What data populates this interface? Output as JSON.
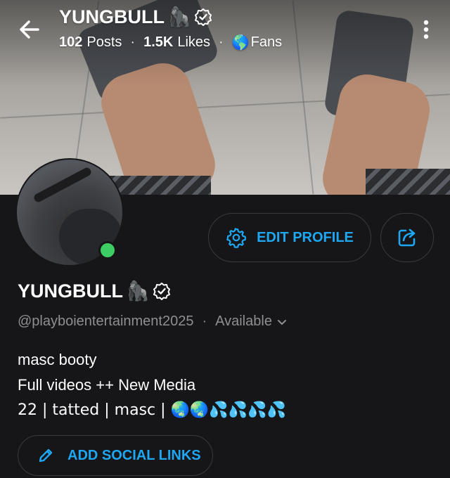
{
  "header": {
    "title": "YUNGBULL",
    "title_emoji": "🦍",
    "posts_count": "102",
    "posts_label": "Posts",
    "likes_count": "1.5K",
    "likes_label": "Likes",
    "fans_emoji": "🌎",
    "fans_label": "Fans",
    "separator": "·"
  },
  "profile": {
    "name": "YUNGBULL",
    "name_emoji": "🦍",
    "handle": "@playboientertainment2025",
    "separator": "·",
    "status": "Available",
    "online_color": "#3ccd64"
  },
  "actions": {
    "edit_profile_label": "EDIT PROFILE",
    "add_social_links_label": "ADD SOCIAL LINKS"
  },
  "bio": {
    "lines": [
      "masc booty",
      "Full videos ++ New Media",
      "22 | tatted | masc | 🌏🌏💦💦💦💦"
    ]
  },
  "icons": {
    "back": "arrow-left-icon",
    "more": "more-vertical-icon",
    "verified": "verified-badge-icon",
    "settings": "gear-icon",
    "share": "share-icon",
    "edit": "pencil-icon",
    "chevron": "chevron-down-icon"
  },
  "colors": {
    "accent": "#1ea7f2",
    "background": "#161618",
    "muted_text": "#8e8e93"
  }
}
